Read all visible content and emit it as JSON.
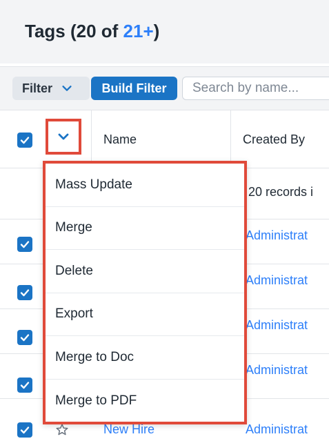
{
  "header": {
    "title_prefix": "Tags (20 of ",
    "title_count_link": "21+",
    "title_suffix": ")"
  },
  "filterbar": {
    "filter_label": "Filter",
    "build_filter_label": "Build Filter",
    "search_placeholder": "Search by name..."
  },
  "table": {
    "columns": [
      "Name",
      "Created By"
    ],
    "records_text": "20 records i",
    "rows": [
      {
        "created_by": "Administrat",
        "checked": true
      },
      {
        "created_by": "Administrat",
        "checked": true
      },
      {
        "created_by": "Administrat",
        "checked": true
      },
      {
        "created_by": "Administrat",
        "checked": true
      },
      {
        "name": "New Hire",
        "created_by": "Administrat",
        "checked": true
      }
    ]
  },
  "actions_menu": {
    "items": [
      "Mass Update",
      "Merge",
      "Delete",
      "Export",
      "Merge to Doc",
      "Merge to PDF"
    ]
  },
  "colors": {
    "accent": "#1b74c5",
    "link": "#2d7ff9",
    "highlight": "#e04a3a"
  }
}
